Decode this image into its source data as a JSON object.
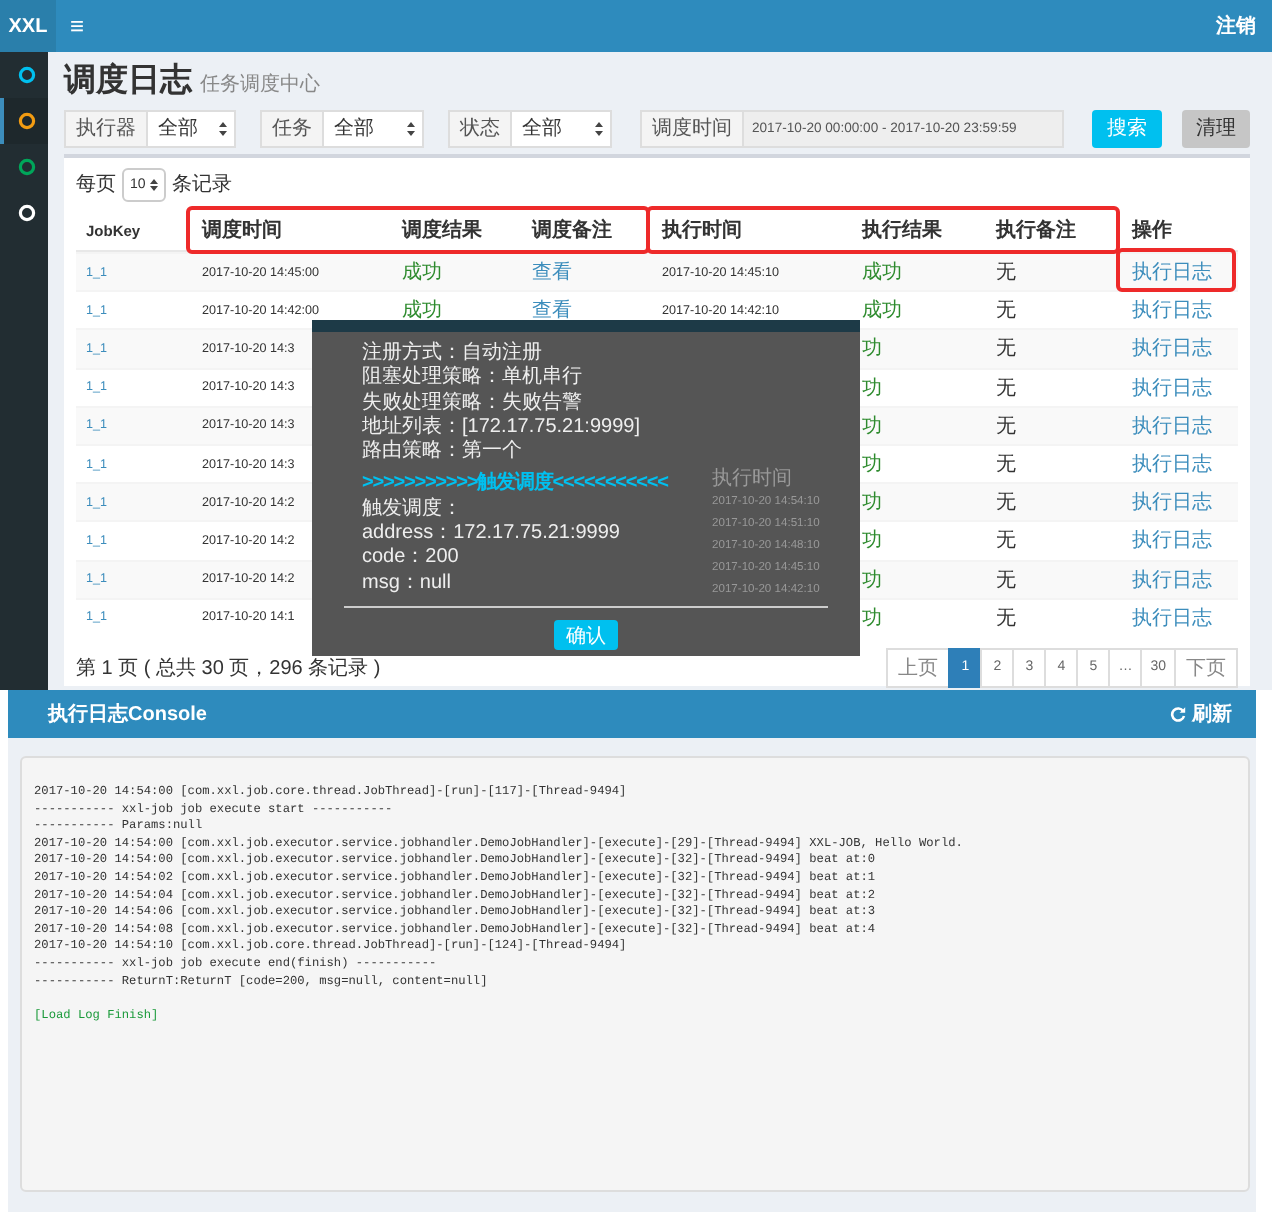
{
  "topbar": {
    "logo": "XXL",
    "menu_toggle": "≡",
    "logout": "注销"
  },
  "sidebar": {
    "items": [
      {
        "color": "#00c0ef",
        "selected": false
      },
      {
        "color": "#f39c12",
        "selected": true
      },
      {
        "color": "#00a65a",
        "selected": false
      },
      {
        "color": "#ffffff",
        "selected": false
      }
    ]
  },
  "page": {
    "title": "调度日志",
    "subtitle": "任务调度中心"
  },
  "filters": {
    "selects": [
      {
        "label": "执行器",
        "value": "全部"
      },
      {
        "label": "任务",
        "value": "全部"
      },
      {
        "label": "状态",
        "value": "全部"
      }
    ],
    "date_range": {
      "label": "调度时间",
      "value": "2017-10-20 00:00:00 - 2017-10-20 23:59:59"
    },
    "buttons": [
      {
        "label": "搜索",
        "kind": "primary"
      },
      {
        "label": "清理",
        "kind": "secondary"
      }
    ]
  },
  "table": {
    "page_size": {
      "before": "每页",
      "value": "10",
      "after": "条记录"
    },
    "columns": [
      {
        "label": "JobKey",
        "highlighted": false
      },
      {
        "label": "调度时间",
        "highlighted": true
      },
      {
        "label": "调度结果",
        "highlighted": true
      },
      {
        "label": "调度备注",
        "highlighted": true
      },
      {
        "label": "执行时间",
        "highlighted": true
      },
      {
        "label": "执行结果",
        "highlighted": true
      },
      {
        "label": "执行备注",
        "highlighted": true
      },
      {
        "label": "操作",
        "highlighted": false
      }
    ],
    "rows": [
      {
        "job_key": "1_1",
        "schedule_time": "2017-10-20 14:45:00",
        "schedule_result": "成功",
        "schedule_remark": "查看",
        "exec_time": "2017-10-20 14:45:10",
        "exec_result": "成功",
        "exec_remark": "无",
        "operation": "执行日志",
        "operation_highlighted": true
      },
      {
        "job_key": "1_1",
        "schedule_time": "2017-10-20 14:42:00",
        "schedule_result": "成功",
        "schedule_remark": "查看",
        "exec_time": "2017-10-20 14:42:10",
        "exec_result": "成功",
        "exec_remark": "无",
        "operation": "执行日志",
        "operation_highlighted": false
      },
      {
        "job_key": "1_1",
        "schedule_time": "2017-10-20 14:3",
        "exec_result": "功",
        "exec_remark": "无",
        "operation": "执行日志",
        "operation_highlighted": false
      },
      {
        "job_key": "1_1",
        "schedule_time": "2017-10-20 14:3",
        "exec_result": "功",
        "exec_remark": "无",
        "operation": "执行日志",
        "operation_highlighted": false
      },
      {
        "job_key": "1_1",
        "schedule_time": "2017-10-20 14:3",
        "exec_result": "功",
        "exec_remark": "无",
        "operation": "执行日志",
        "operation_highlighted": false
      },
      {
        "job_key": "1_1",
        "schedule_time": "2017-10-20 14:3",
        "exec_result": "功",
        "exec_remark": "无",
        "operation": "执行日志",
        "operation_highlighted": false
      },
      {
        "job_key": "1_1",
        "schedule_time": "2017-10-20 14:2",
        "exec_result": "功",
        "exec_remark": "无",
        "operation": "执行日志",
        "operation_highlighted": false
      },
      {
        "job_key": "1_1",
        "schedule_time": "2017-10-20 14:2",
        "exec_result": "功",
        "exec_remark": "无",
        "operation": "执行日志",
        "operation_highlighted": false
      },
      {
        "job_key": "1_1",
        "schedule_time": "2017-10-20 14:2",
        "exec_result": "功",
        "exec_remark": "无",
        "operation": "执行日志",
        "operation_highlighted": false
      },
      {
        "job_key": "1_1",
        "schedule_time": "2017-10-20 14:1",
        "exec_result": "功",
        "exec_remark": "无",
        "operation": "执行日志",
        "operation_highlighted": false
      }
    ],
    "summary": "第 1 页 ( 总共 30 页，296 条记录 )",
    "pagination": [
      {
        "label": "上页",
        "selected": false
      },
      {
        "label": "1",
        "selected": true
      },
      {
        "label": "2",
        "selected": false
      },
      {
        "label": "3",
        "selected": false
      },
      {
        "label": "4",
        "selected": false
      },
      {
        "label": "5",
        "selected": false
      },
      {
        "label": "…",
        "selected": false
      },
      {
        "label": "30",
        "selected": false
      },
      {
        "label": "下页",
        "selected": false
      }
    ]
  },
  "dialog": {
    "lines": [
      {
        "text": "注册方式：自动注册",
        "kind": "text"
      },
      {
        "text": "阻塞处理策略：单机串行",
        "kind": "text"
      },
      {
        "text": "失败处理策略：失败告警",
        "kind": "text"
      },
      {
        "text": "地址列表：[172.17.75.21:9999]",
        "kind": "text"
      },
      {
        "text": "路由策略：第一个",
        "kind": "text"
      },
      {
        "text": ">>>>>>>>>>>触发调度<<<<<<<<<<<",
        "kind": "divider"
      },
      {
        "text": "触发调度：",
        "kind": "text"
      },
      {
        "text": "address：172.17.75.21:9999",
        "kind": "text"
      },
      {
        "text": "code：200",
        "kind": "text"
      },
      {
        "text": "msg：null",
        "kind": "text"
      }
    ],
    "background_table": {
      "column": "执行时间",
      "rows": [
        "2017-10-20 14:54:10",
        "2017-10-20 14:51:10",
        "2017-10-20 14:48:10",
        "2017-10-20 14:45:10",
        "2017-10-20 14:42:10"
      ]
    },
    "confirm": "确认"
  },
  "console": {
    "title": "执行日志Console",
    "refresh": "刷新",
    "lines": [
      {
        "text": "2017-10-20 14:54:00 [com.xxl.job.core.thread.JobThread]-[run]-[117]-[Thread-9494]",
        "kind": "log"
      },
      {
        "text": "----------- xxl-job job execute start -----------",
        "kind": "log"
      },
      {
        "text": "----------- Params:null",
        "kind": "log"
      },
      {
        "text": "2017-10-20 14:54:00 [com.xxl.job.executor.service.jobhandler.DemoJobHandler]-[execute]-[29]-[Thread-9494] XXL-JOB, Hello World.",
        "kind": "log"
      },
      {
        "text": "2017-10-20 14:54:00 [com.xxl.job.executor.service.jobhandler.DemoJobHandler]-[execute]-[32]-[Thread-9494] beat at:0",
        "kind": "log"
      },
      {
        "text": "2017-10-20 14:54:02 [com.xxl.job.executor.service.jobhandler.DemoJobHandler]-[execute]-[32]-[Thread-9494] beat at:1",
        "kind": "log"
      },
      {
        "text": "2017-10-20 14:54:04 [com.xxl.job.executor.service.jobhandler.DemoJobHandler]-[execute]-[32]-[Thread-9494] beat at:2",
        "kind": "log"
      },
      {
        "text": "2017-10-20 14:54:06 [com.xxl.job.executor.service.jobhandler.DemoJobHandler]-[execute]-[32]-[Thread-9494] beat at:3",
        "kind": "log"
      },
      {
        "text": "2017-10-20 14:54:08 [com.xxl.job.executor.service.jobhandler.DemoJobHandler]-[execute]-[32]-[Thread-9494] beat at:4",
        "kind": "log"
      },
      {
        "text": "2017-10-20 14:54:10 [com.xxl.job.core.thread.JobThread]-[run]-[124]-[Thread-9494]",
        "kind": "log"
      },
      {
        "text": "----------- xxl-job job execute end(finish) -----------",
        "kind": "log"
      },
      {
        "text": "----------- ReturnT:ReturnT [code=200, msg=null, content=null]",
        "kind": "log"
      },
      {
        "text": "[Load Log Finish]",
        "kind": "finish"
      }
    ]
  }
}
